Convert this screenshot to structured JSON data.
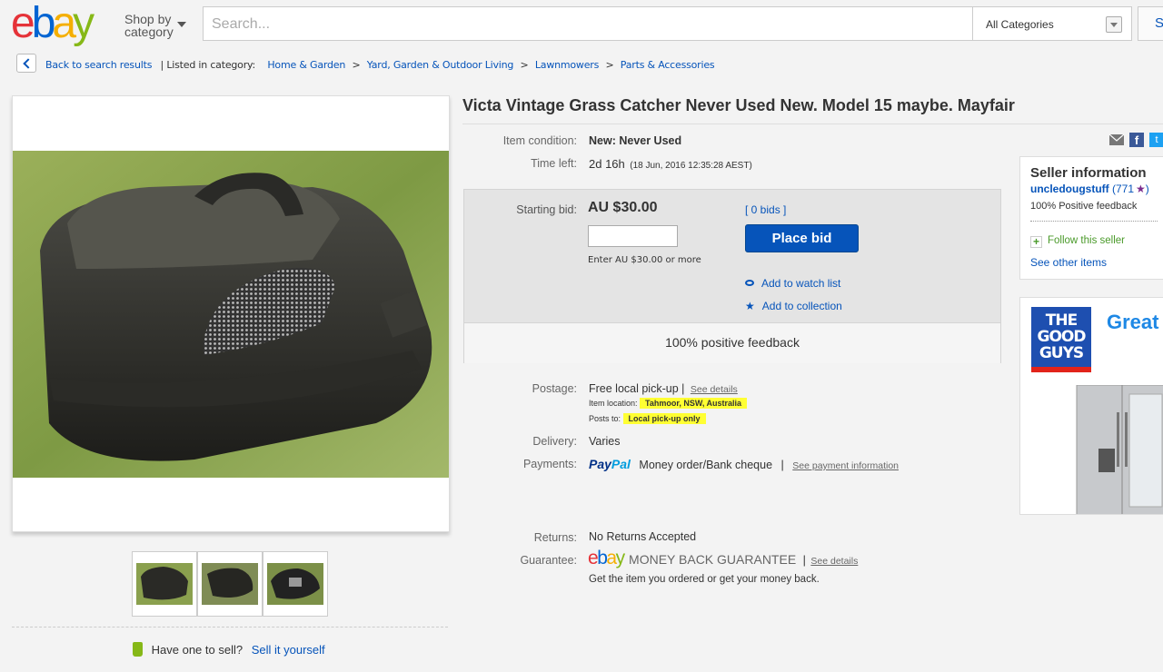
{
  "header": {
    "logo": [
      "e",
      "b",
      "a",
      "y"
    ],
    "logo_colors": [
      "#e53238",
      "#0064d2",
      "#f5af02",
      "#86b817"
    ],
    "shop_by": "Shop by",
    "shop_by_2": "category",
    "search_placeholder": "Search...",
    "category": "All Categories",
    "search_button": "S"
  },
  "breadcrumb": {
    "back": "Back to search results",
    "listed": "| Listed in category:",
    "items": [
      "Home & Garden",
      "Yard, Garden & Outdoor Living",
      "Lawnmowers",
      "Parts & Accessories"
    ],
    "sep": ">"
  },
  "listing": {
    "title": "Victa Vintage Grass Catcher Never Used New. Model 15 maybe. Mayfair",
    "condition_label": "Item condition:",
    "condition": "New: Never Used",
    "time_left_label": "Time left:",
    "time_left": "2d 16h",
    "time_left_detail": "(18 Jun, 2016  12:35:28 AEST)",
    "starting_bid_label": "Starting bid:",
    "starting_bid": "AU $30.00",
    "bids": "[ 0 bids ]",
    "enter_hint": "Enter AU $30.00 or more",
    "place_bid": "Place bid",
    "watch": "Add to watch list",
    "collection": "Add to collection",
    "positive": "100% positive feedback",
    "postage_label": "Postage:",
    "postage": "Free local pick-up |",
    "see_details": "See details",
    "item_location_label": "Item location:",
    "item_location": "Tahmoor, NSW, Australia",
    "posts_to_label": "Posts to:",
    "posts_to": "Local pick-up only",
    "delivery_label": "Delivery:",
    "delivery": "Varies",
    "payments_label": "Payments:",
    "paypal_1": "Pay",
    "paypal_2": "Pal",
    "payments": "Money order/Bank cheque",
    "pipe": "|",
    "see_payment": "See payment information",
    "returns_label": "Returns:",
    "returns": "No Returns Accepted",
    "guarantee_label": "Guarantee:",
    "guarantee_logo": [
      "e",
      "b",
      "a",
      "y"
    ],
    "guarantee": "MONEY BACK GUARANTEE",
    "guarantee_details": "See details",
    "guarantee_sub": "Get the item you ordered or get your money back."
  },
  "seller": {
    "heading": "Seller information",
    "name": "uncledougstuff",
    "score": "(771",
    "score_end": ")",
    "feedback": "100% Positive feedback",
    "follow": "Follow this seller",
    "other": "See other items"
  },
  "ad": {
    "brand_1": "THE",
    "brand_2": "GOOD",
    "brand_3": "GUYS",
    "slogan": "Great"
  },
  "sell": {
    "have_one": "Have one to sell?",
    "sell_it": "Sell it yourself"
  }
}
